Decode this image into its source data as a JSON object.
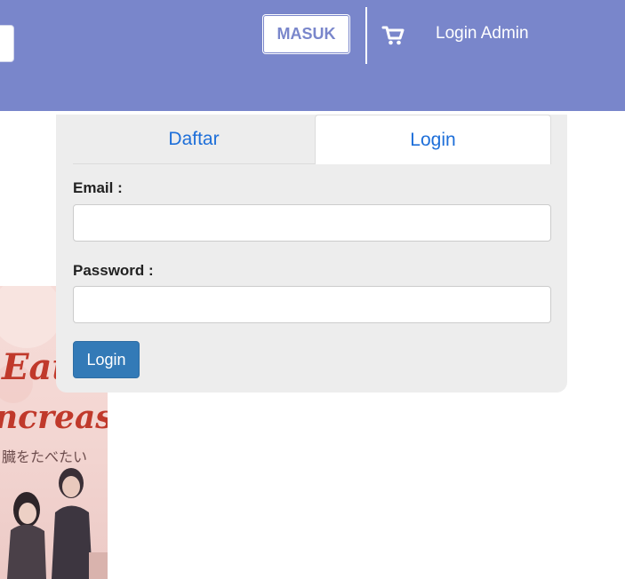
{
  "header": {
    "masuk_label": "MASUK",
    "login_admin_label": "Login Admin",
    "cart_icon": "shopping-cart-icon",
    "bg_color": "#7986cb"
  },
  "book": {
    "title_fragment_1": "Eat",
    "title_fragment_2": "ncreas",
    "japanese_text": "臓をたべたい"
  },
  "auth": {
    "tabs": [
      {
        "label": "Daftar",
        "active": false
      },
      {
        "label": "Login",
        "active": true
      }
    ],
    "email_label": "Email :",
    "email_value": "",
    "password_label": "Password :",
    "password_value": "",
    "submit_label": "Login"
  },
  "colors": {
    "accent": "#7986cb",
    "link": "#1e6fd9",
    "primary_button": "#337ab7",
    "panel_bg": "#ededed"
  }
}
